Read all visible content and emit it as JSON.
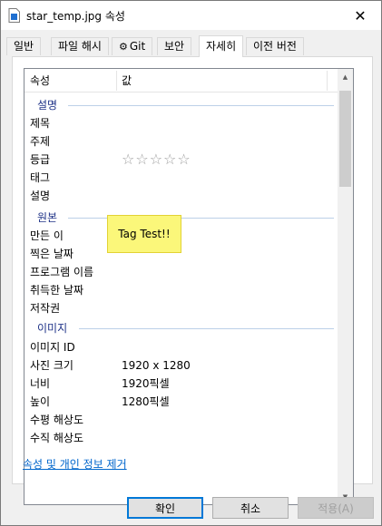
{
  "window": {
    "title": "star_temp.jpg 속성",
    "close_glyph": "✕"
  },
  "tabs": [
    {
      "label": "일반",
      "active": false
    },
    {
      "label": "파일 해시",
      "active": false
    },
    {
      "label": "Git",
      "active": false,
      "icon": "git-icon"
    },
    {
      "label": "보안",
      "active": false
    },
    {
      "label": "자세히",
      "active": true
    },
    {
      "label": "이전 버전",
      "active": false
    }
  ],
  "list": {
    "headers": {
      "property": "속성",
      "value": "값"
    },
    "groups": {
      "description": "설명",
      "origin": "원본",
      "image": "이미지"
    },
    "rows": {
      "title": {
        "key": "제목",
        "value": ""
      },
      "subject": {
        "key": "주제",
        "value": ""
      },
      "rating": {
        "key": "등급",
        "value": "☆☆☆☆☆",
        "stars": 0,
        "max_stars": 5
      },
      "tags": {
        "key": "태그",
        "value": ""
      },
      "comments": {
        "key": "설명",
        "value": ""
      },
      "authors": {
        "key": "만든 이",
        "value": ""
      },
      "date_taken": {
        "key": "찍은 날짜",
        "value": ""
      },
      "program": {
        "key": "프로그램 이름",
        "value": ""
      },
      "date_acquired": {
        "key": "취득한 날짜",
        "value": ""
      },
      "copyright": {
        "key": "저작권",
        "value": ""
      },
      "image_id": {
        "key": "이미지 ID",
        "value": ""
      },
      "dimensions": {
        "key": "사진 크기",
        "value": "1920 x 1280"
      },
      "width": {
        "key": "너비",
        "value": "1920픽셀"
      },
      "height": {
        "key": "높이",
        "value": "1280픽셀"
      },
      "h_resolution": {
        "key": "수평 해상도",
        "value": ""
      },
      "v_resolution": {
        "key": "수직 해상도",
        "value": ""
      }
    }
  },
  "tooltip": {
    "text": "Tag Test!!"
  },
  "links": {
    "remove_properties": "속성 및 개인 정보 제거"
  },
  "buttons": {
    "ok": "확인",
    "cancel": "취소",
    "apply": "적용(A)"
  },
  "colors": {
    "group_text": "#1e3287",
    "link": "#0066cc",
    "tooltip_bg": "#fbf77a",
    "focus_border": "#0078d7"
  }
}
